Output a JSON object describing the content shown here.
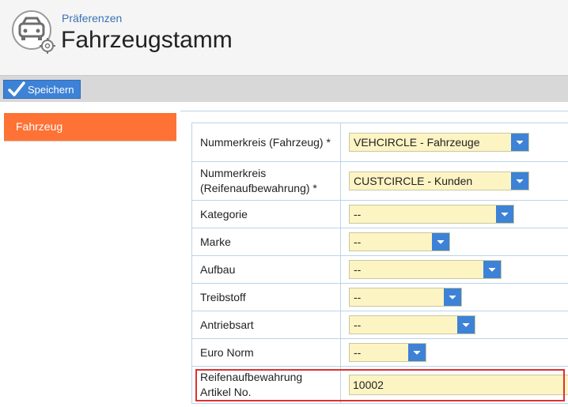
{
  "header": {
    "breadcrumb": "Präferenzen",
    "title": "Fahrzeugstamm"
  },
  "toolbar": {
    "save_label": "Speichern"
  },
  "sidebar": {
    "items": [
      {
        "label": "Fahrzeug",
        "active": true
      }
    ]
  },
  "colors": {
    "accent_blue": "#3d82d6",
    "sidebar_active": "#fe7235",
    "input_background": "#fdf4c4",
    "highlight_border": "#e03030"
  },
  "form": {
    "fields": [
      {
        "label": "Nummerkreis (Fahrzeug) *",
        "value": "VEHCIRCLE - Fahrzeuge"
      },
      {
        "label": "Nummerkreis (Reifenaufbewahrung) *",
        "value": "CUSTCIRCLE - Kunden"
      },
      {
        "label": "Kategorie",
        "value": "--"
      },
      {
        "label": "Marke",
        "value": "--"
      },
      {
        "label": "Aufbau",
        "value": "--"
      },
      {
        "label": "Treibstoff",
        "value": "--"
      },
      {
        "label": "Antriebsart",
        "value": "--"
      },
      {
        "label": "Euro Norm",
        "value": "--"
      },
      {
        "label": "Reifenaufbewahrung Artikel No.",
        "value": "10002"
      }
    ]
  }
}
